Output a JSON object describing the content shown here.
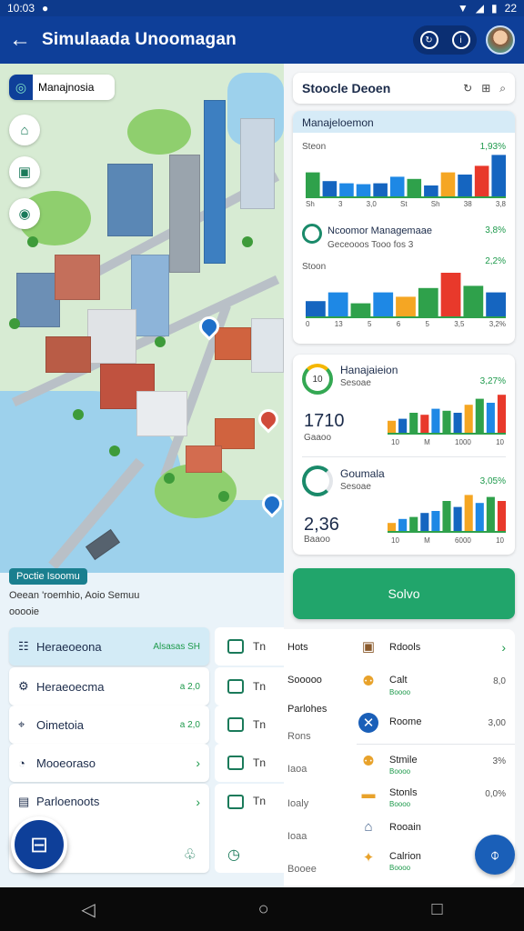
{
  "status_bar": {
    "time": "10:03",
    "battery": "22"
  },
  "app_bar": {
    "title": "Simulaada Unoomagan"
  },
  "map": {
    "search_label": "Manajnosia"
  },
  "info_strip": {
    "tag": "Poctie Isoomu",
    "line1": "Oeean 'roemhio, Aoio Semuu",
    "line2": "ooooie"
  },
  "left_list": [
    {
      "label": "Heraeoeona",
      "value": "Alsasas SH"
    },
    {
      "label": "Heraeoecma",
      "value": "a 2,0"
    },
    {
      "label": "Oimetoia",
      "value": "a 2,0"
    },
    {
      "label": "Mooeoraso",
      "value": ""
    },
    {
      "label": "Parloenoots",
      "value": ""
    }
  ],
  "mid_list": [
    "Tn",
    "Tn",
    "Tn",
    "Tn",
    "Tn"
  ],
  "right_panel": {
    "search_title": "Stoocle Deoen",
    "card1": {
      "header": "Manajeloemon",
      "row1_label": "Steon",
      "row1_pct": "1,93%",
      "row2_title": "Ncoomor Managemaae",
      "row2_sub": "Geceooos Tooo fos 3",
      "row2_pct": "3,8%",
      "row3_label": "Stoon",
      "row3_pct": "2,2%",
      "axis1": [
        "Sh",
        "3",
        "3,0",
        "St",
        "Sh",
        "38",
        "3,8"
      ],
      "axis2": [
        "0",
        "13",
        "5",
        "6",
        "5",
        "3,5",
        "3,2%"
      ]
    },
    "card2": {
      "title1": "Hanajaieion",
      "sub1": "Sesoae",
      "pct1": "3,27%",
      "num1": "1710",
      "num1_sub": "Gaaoo",
      "axis1": [
        "10",
        "M",
        "1000",
        "10"
      ],
      "title2": "Goumala",
      "sub2": "Sesoae",
      "pct2": "3,05%",
      "num2": "2,36",
      "num2_sub": "Baaoo",
      "axis2": [
        "10",
        "M",
        "6000",
        "10"
      ]
    },
    "solve_label": "Solvo",
    "resources": [
      {
        "left": "Hots",
        "name": "Rdools",
        "sub": "",
        "value": ""
      },
      {
        "left": "Sooooo",
        "name": "Calt",
        "sub": "Boooo",
        "value": "8,0"
      },
      {
        "left": "Parlohes",
        "name": "Roome",
        "sub": "",
        "value": "3,00"
      },
      {
        "left": "Rons",
        "name": "Stmile",
        "sub": "Boooo",
        "value": "3%"
      },
      {
        "left": "Iaoa",
        "name": "Stonls",
        "sub": "Boooo",
        "value": "0,0%"
      },
      {
        "left": "Ioaly",
        "name": "Rooain",
        "sub": "",
        "value": ""
      },
      {
        "left": "Ioaa",
        "name": "Calrion",
        "sub": "Boooo",
        "value": ""
      },
      {
        "left": "Booee",
        "name": "",
        "sub": "",
        "value": ""
      }
    ]
  },
  "charts": {
    "bars1": [
      {
        "v": 0.55,
        "c": "#2fa14b"
      },
      {
        "v": 0.35,
        "c": "#1565c0"
      },
      {
        "v": 0.3,
        "c": "#1e88e5"
      },
      {
        "v": 0.28,
        "c": "#1e88e5"
      },
      {
        "v": 0.3,
        "c": "#1565c0"
      },
      {
        "v": 0.45,
        "c": "#1e88e5"
      },
      {
        "v": 0.4,
        "c": "#2fa14b"
      },
      {
        "v": 0.25,
        "c": "#1565c0"
      },
      {
        "v": 0.55,
        "c": "#f5a623"
      },
      {
        "v": 0.5,
        "c": "#1565c0"
      },
      {
        "v": 0.7,
        "c": "#e8392b"
      },
      {
        "v": 0.95,
        "c": "#1565c0"
      }
    ],
    "bars2": [
      {
        "v": 0.35,
        "c": "#1565c0"
      },
      {
        "v": 0.55,
        "c": "#1e88e5"
      },
      {
        "v": 0.3,
        "c": "#2fa14b"
      },
      {
        "v": 0.55,
        "c": "#1e88e5"
      },
      {
        "v": 0.45,
        "c": "#f5a623"
      },
      {
        "v": 0.65,
        "c": "#2fa14b"
      },
      {
        "v": 1.0,
        "c": "#e8392b"
      },
      {
        "v": 0.7,
        "c": "#2fa14b"
      },
      {
        "v": 0.55,
        "c": "#1565c0"
      }
    ],
    "bars3": [
      {
        "v": 0.3,
        "c": "#f5a623"
      },
      {
        "v": 0.35,
        "c": "#1565c0"
      },
      {
        "v": 0.5,
        "c": "#2fa14b"
      },
      {
        "v": 0.45,
        "c": "#e8392b"
      },
      {
        "v": 0.6,
        "c": "#1e88e5"
      },
      {
        "v": 0.55,
        "c": "#2fa14b"
      },
      {
        "v": 0.5,
        "c": "#1565c0"
      },
      {
        "v": 0.7,
        "c": "#f5a623"
      },
      {
        "v": 0.85,
        "c": "#2fa14b"
      },
      {
        "v": 0.75,
        "c": "#1e88e5"
      },
      {
        "v": 0.95,
        "c": "#e8392b"
      }
    ],
    "bars4": [
      {
        "v": 0.2,
        "c": "#f5a623"
      },
      {
        "v": 0.3,
        "c": "#1e88e5"
      },
      {
        "v": 0.35,
        "c": "#2fa14b"
      },
      {
        "v": 0.45,
        "c": "#1565c0"
      },
      {
        "v": 0.5,
        "c": "#1e88e5"
      },
      {
        "v": 0.75,
        "c": "#2fa14b"
      },
      {
        "v": 0.6,
        "c": "#1565c0"
      },
      {
        "v": 0.9,
        "c": "#f5a623"
      },
      {
        "v": 0.7,
        "c": "#1e88e5"
      },
      {
        "v": 0.85,
        "c": "#2fa14b"
      },
      {
        "v": 0.75,
        "c": "#e8392b"
      }
    ]
  },
  "nav": {
    "back": "◁",
    "home": "○",
    "recents": "□"
  }
}
